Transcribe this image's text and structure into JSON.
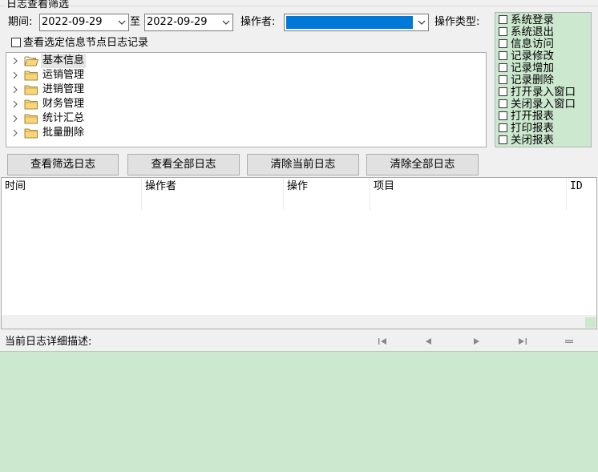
{
  "filter": {
    "group_title": "日志查看筛选",
    "period_label": "期间:",
    "date_from": "2022-09-29",
    "to_label": "至",
    "date_to": "2022-09-29",
    "operator_label": "操作者:",
    "operator_value": "",
    "op_type_label": "操作类型:",
    "node_filter_label": "查看选定信息节点日志记录"
  },
  "tree": {
    "items": [
      {
        "label": "基本信息",
        "selected": true
      },
      {
        "label": "运销管理",
        "selected": false
      },
      {
        "label": "进销管理",
        "selected": false
      },
      {
        "label": "财务管理",
        "selected": false
      },
      {
        "label": "统计汇总",
        "selected": false
      },
      {
        "label": "批量删除",
        "selected": false
      }
    ]
  },
  "op_types": [
    "系统登录",
    "系统退出",
    "信息访问",
    "记录修改",
    "记录增加",
    "记录删除",
    "打开录入窗口",
    "关闭录入窗口",
    "打开报表",
    "打印报表",
    "关闭报表"
  ],
  "buttons": {
    "view_filtered": "查看筛选日志",
    "view_all": "查看全部日志",
    "clear_current": "清除当前日志",
    "clear_all": "清除全部日志"
  },
  "grid": {
    "columns": [
      "时间",
      "操作者",
      "操作",
      "项目",
      "ID"
    ]
  },
  "detail": {
    "label": "当前日志详细描述:"
  },
  "colors": {
    "panel_green": "#cce8cf",
    "selection_blue": "#0078d7",
    "window_bg": "#f0f0f0"
  }
}
